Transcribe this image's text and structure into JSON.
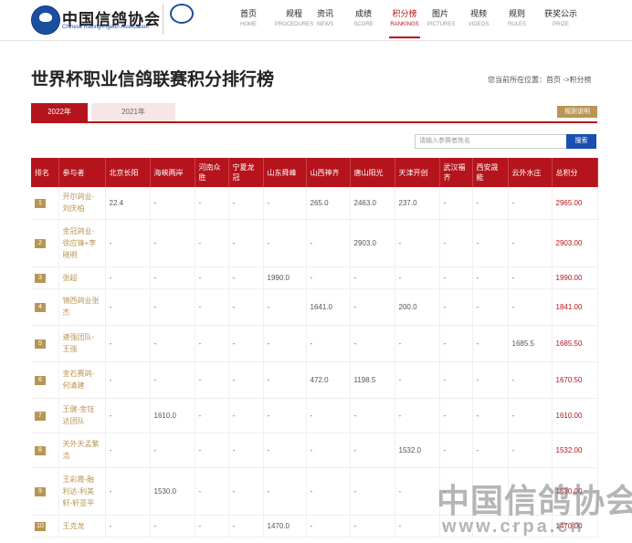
{
  "brand": {
    "cn": "中国信鸽协会",
    "en": "Chinese Racing Pigeon Association"
  },
  "nav": [
    {
      "cn": "首页",
      "en": "HOME",
      "active": false
    },
    {
      "cn": "规程",
      "en": "PROCEDURES",
      "active": false
    },
    {
      "cn": "资讯",
      "en": "NEWS",
      "active": false
    },
    {
      "cn": "成绩",
      "en": "SCORE",
      "active": false
    },
    {
      "cn": "积分榜",
      "en": "RANKINGS",
      "active": true
    },
    {
      "cn": "图片",
      "en": "PICTURES",
      "active": false
    },
    {
      "cn": "视频",
      "en": "VIDEOS",
      "active": false
    },
    {
      "cn": "规则",
      "en": "RULES",
      "active": false
    },
    {
      "cn": "获奖公示",
      "en": "PRIZE",
      "active": false
    }
  ],
  "page_title": "世界杯职业信鸽联赛积分排行榜",
  "breadcrumb": {
    "prefix": "您当前所在位置：",
    "path": "首页 ->积分榜"
  },
  "tabs": [
    "2022年",
    "2021年"
  ],
  "rules_label": "规则说明",
  "search": {
    "placeholder": "请输入参赛者姓名",
    "button": "搜索"
  },
  "table": {
    "headers": [
      "排名",
      "参与者",
      "北京长阳",
      "海峡两岸",
      "河南众胜",
      "宁夏龙冠",
      "山东舜峰",
      "山西神齐",
      "唐山阳光",
      "天津开创",
      "武汉福齐",
      "西安晟能",
      "云外水庄",
      "总积分"
    ],
    "rows": [
      {
        "rank": "1",
        "name": "开尔鸽业-刘庆柏",
        "vals": [
          "22.4",
          "-",
          "-",
          "-",
          "-",
          "265.0",
          "2463.0",
          "237.0",
          "-",
          "-",
          "-"
        ],
        "total": "2965.00"
      },
      {
        "rank": "2",
        "name": "金冠鸽业-徐应锋+李晓明",
        "vals": [
          "-",
          "-",
          "-",
          "-",
          "-",
          "-",
          "2903.0",
          "-",
          "-",
          "-",
          "-"
        ],
        "total": "2903.00"
      },
      {
        "rank": "3",
        "name": "张超",
        "vals": [
          "-",
          "-",
          "-",
          "-",
          "1990.0",
          "-",
          "-",
          "-",
          "-",
          "-",
          "-"
        ],
        "total": "1990.00"
      },
      {
        "rank": "4",
        "name": "锦西鸽业张杰",
        "vals": [
          "-",
          "-",
          "-",
          "-",
          "-",
          "1641.0",
          "-",
          "200.0",
          "-",
          "-",
          "-"
        ],
        "total": "1841.00"
      },
      {
        "rank": "5",
        "name": "速强团队-王强",
        "vals": [
          "-",
          "-",
          "-",
          "-",
          "-",
          "-",
          "-",
          "-",
          "-",
          "-",
          "1685.5"
        ],
        "total": "1685.50"
      },
      {
        "rank": "6",
        "name": "金石赛鸽-何清建",
        "vals": [
          "-",
          "-",
          "-",
          "-",
          "-",
          "472.0",
          "1198.5",
          "-",
          "-",
          "-",
          "-"
        ],
        "total": "1670.50"
      },
      {
        "rank": "7",
        "name": "王健-金钰达团队",
        "vals": [
          "-",
          "1610.0",
          "-",
          "-",
          "-",
          "-",
          "-",
          "-",
          "-",
          "-",
          "-"
        ],
        "total": "1610.00"
      },
      {
        "rank": "8",
        "name": "天外天孟繁浩",
        "vals": [
          "-",
          "-",
          "-",
          "-",
          "-",
          "-",
          "-",
          "1532.0",
          "-",
          "-",
          "-"
        ],
        "total": "1532.00"
      },
      {
        "rank": "9",
        "name": "王彩霞-融利达-利美轩-轩亚平",
        "vals": [
          "-",
          "1530.0",
          "-",
          "-",
          "-",
          "-",
          "-",
          "-",
          "-",
          "-",
          "-"
        ],
        "total": "1530.00"
      },
      {
        "rank": "10",
        "name": "王克龙",
        "vals": [
          "-",
          "-",
          "-",
          "-",
          "1470.0",
          "-",
          "-",
          "-",
          "-",
          "-",
          "-"
        ],
        "total": "1470.00"
      }
    ]
  },
  "watermark": {
    "cn": "中国信鸽协会",
    "en": "www.crpa.cn"
  }
}
